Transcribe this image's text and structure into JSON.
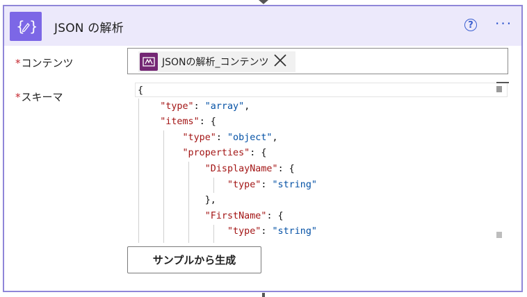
{
  "header": {
    "title": "JSON の解析",
    "icon": "json-braces-pencil-icon",
    "help_icon_glyph": "?",
    "more_glyph": "···",
    "accent_color": "#7c67e6",
    "header_bg": "#ece9fb"
  },
  "fields": {
    "content": {
      "required_mark": "*",
      "label": "コンテンツ",
      "token": {
        "label": "JSONの解析_コンテンツ",
        "icon": "power-apps-icon",
        "icon_color": "#742774"
      }
    },
    "schema": {
      "required_mark": "*",
      "label": "スキーマ"
    }
  },
  "schema_code": [
    [
      {
        "t": "p",
        "v": "{"
      }
    ],
    [
      {
        "t": "p",
        "v": "    "
      },
      {
        "t": "k",
        "v": "\"type\""
      },
      {
        "t": "p",
        "v": ": "
      },
      {
        "t": "s",
        "v": "\"array\""
      },
      {
        "t": "p",
        "v": ","
      }
    ],
    [
      {
        "t": "p",
        "v": "    "
      },
      {
        "t": "k",
        "v": "\"items\""
      },
      {
        "t": "p",
        "v": ": {"
      }
    ],
    [
      {
        "t": "p",
        "v": "        "
      },
      {
        "t": "k",
        "v": "\"type\""
      },
      {
        "t": "p",
        "v": ": "
      },
      {
        "t": "s",
        "v": "\"object\""
      },
      {
        "t": "p",
        "v": ","
      }
    ],
    [
      {
        "t": "p",
        "v": "        "
      },
      {
        "t": "k",
        "v": "\"properties\""
      },
      {
        "t": "p",
        "v": ": {"
      }
    ],
    [
      {
        "t": "p",
        "v": "            "
      },
      {
        "t": "k",
        "v": "\"DisplayName\""
      },
      {
        "t": "p",
        "v": ": {"
      }
    ],
    [
      {
        "t": "p",
        "v": "                "
      },
      {
        "t": "k",
        "v": "\"type\""
      },
      {
        "t": "p",
        "v": ": "
      },
      {
        "t": "s",
        "v": "\"string\""
      }
    ],
    [
      {
        "t": "p",
        "v": "            },"
      }
    ],
    [
      {
        "t": "p",
        "v": "            "
      },
      {
        "t": "k",
        "v": "\"FirstName\""
      },
      {
        "t": "p",
        "v": ": {"
      }
    ],
    [
      {
        "t": "p",
        "v": "                "
      },
      {
        "t": "k",
        "v": "\"type\""
      },
      {
        "t": "p",
        "v": ": "
      },
      {
        "t": "s",
        "v": "\"string\""
      }
    ]
  ],
  "buttons": {
    "generate_from_sample": "サンプルから生成"
  }
}
